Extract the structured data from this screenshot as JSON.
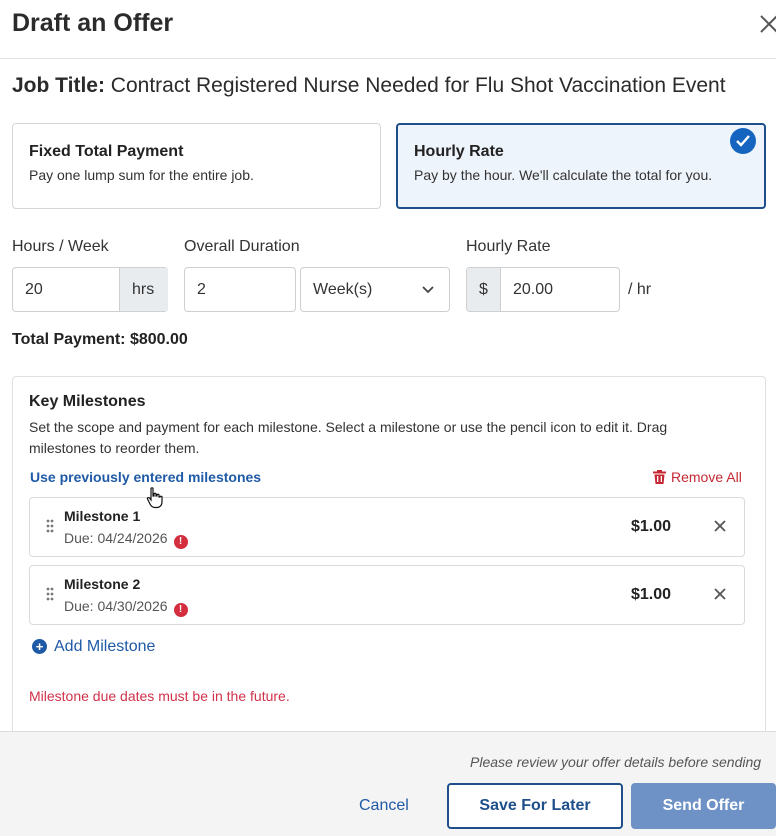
{
  "modal": {
    "title": "Draft an Offer"
  },
  "job": {
    "prefix": "Job Title:",
    "title": "Contract Registered Nurse Needed for Flu Shot Vaccination Event"
  },
  "payment_types": {
    "fixed": {
      "title": "Fixed Total Payment",
      "desc": "Pay one lump sum for the entire job.",
      "selected": false
    },
    "hourly": {
      "title": "Hourly Rate",
      "desc": "Pay by the hour. We'll calculate the total for you.",
      "selected": true
    }
  },
  "fields": {
    "hours_week": {
      "label": "Hours / Week",
      "value": "20",
      "unit": "hrs"
    },
    "duration": {
      "label": "Overall Duration",
      "value": "2",
      "unit_selected": "Week(s)"
    },
    "hourly_rate": {
      "label": "Hourly Rate",
      "prefix": "$",
      "value": "20.00",
      "suffix": "/ hr"
    }
  },
  "total": "Total Payment: $800.00",
  "milestones": {
    "title": "Key Milestones",
    "description": "Set the scope and payment for each milestone. Select a milestone or use the pencil icon to edit it. Drag milestones to reorder them.",
    "use_previous": "Use previously entered milestones",
    "remove_all": "Remove All",
    "items": [
      {
        "name": "Milestone 1",
        "due": "Due: 04/24/2026",
        "amount": "$1.00"
      },
      {
        "name": "Milestone 2",
        "due": "Due: 04/30/2026",
        "amount": "$1.00"
      }
    ],
    "add_label": "Add Milestone",
    "error": "Milestone due dates must be in the future."
  },
  "footer": {
    "note": "Please review your offer details before sending",
    "cancel": "Cancel",
    "save": "Save For Later",
    "send": "Send Offer"
  },
  "colors": {
    "primary": "#1e4f8a",
    "link": "#1f5aa6",
    "error": "#d0324a",
    "send_button": "#6f92c6"
  }
}
